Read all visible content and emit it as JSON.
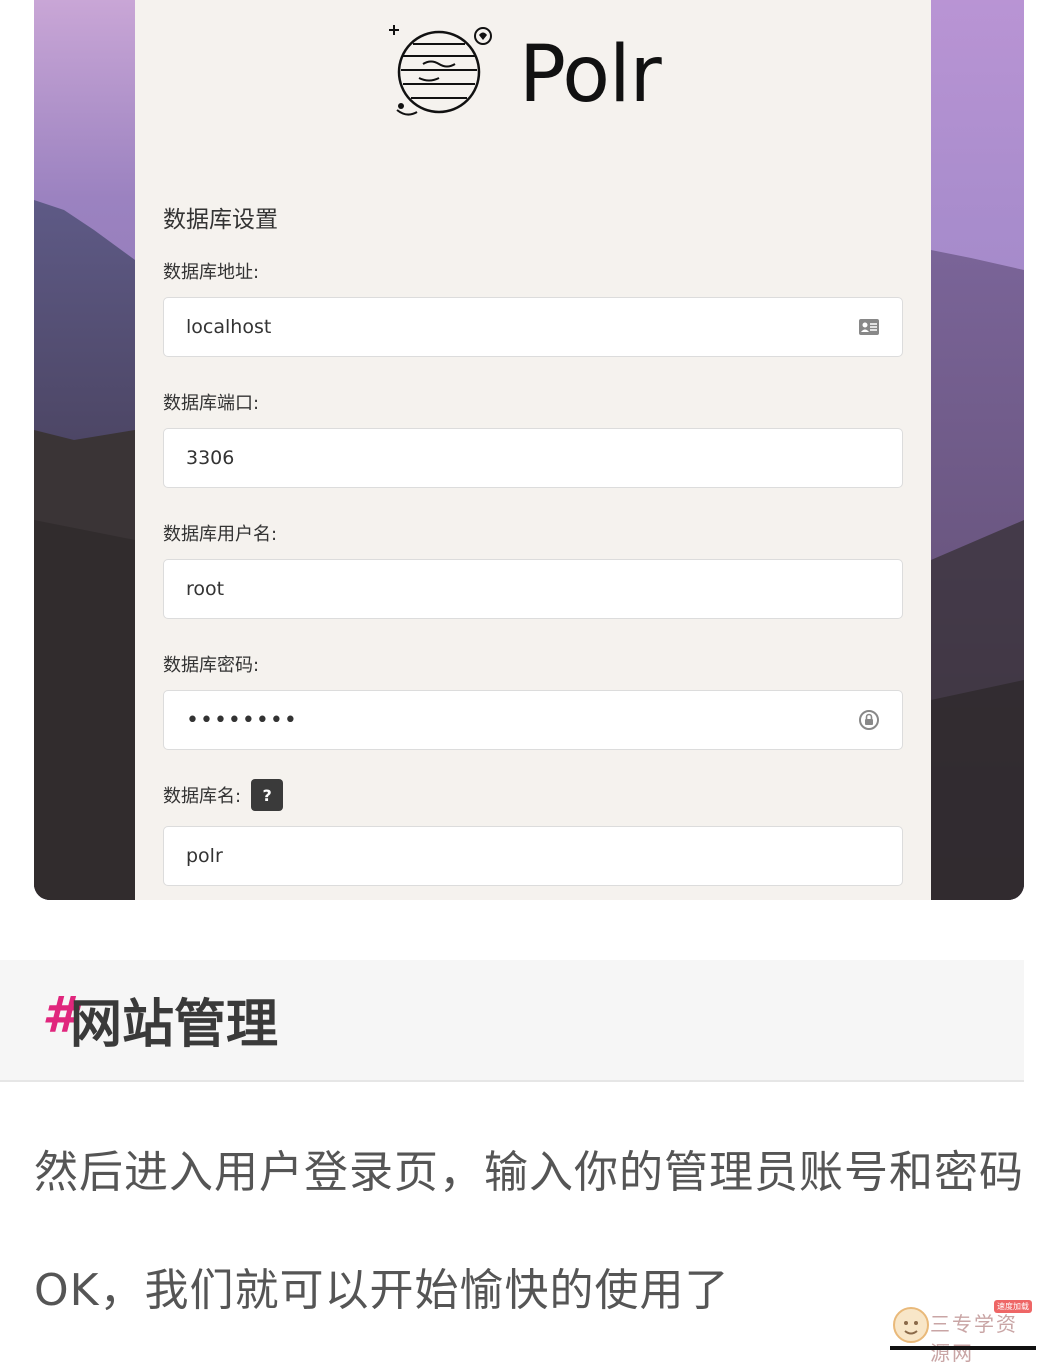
{
  "screenshot": {
    "brand": "Polr",
    "section_title": "数据库设置",
    "fields": [
      {
        "label": "数据库地址:",
        "value": "localhost",
        "icon": "contact-card-icon"
      },
      {
        "label": "数据库端口:",
        "value": "3306"
      },
      {
        "label": "数据库用户名:",
        "value": "root"
      },
      {
        "label": "数据库密码:",
        "value": "••••••••",
        "icon": "password-key-icon"
      },
      {
        "label": "数据库名:",
        "value": "polr",
        "help": "?"
      }
    ]
  },
  "article": {
    "heading_hash": "#",
    "heading": "网站管理",
    "paragraphs": [
      "然后进入用户登录页，输入你的管理员账号和密码",
      "OK，我们就可以开始愉快的使用了"
    ]
  },
  "watermark": {
    "text": "三专学资源网",
    "tag": "速度加载"
  },
  "colors": {
    "accent": "#e0267d",
    "panel": "#f5f2ee"
  }
}
